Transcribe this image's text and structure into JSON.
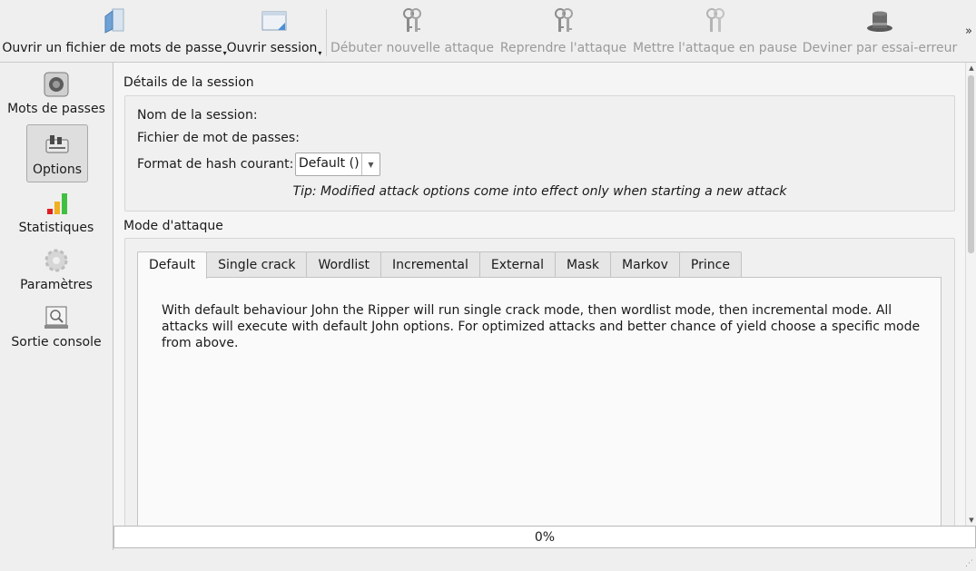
{
  "toolbar": {
    "open_password_file": "Ouvrir un fichier de mots de passe",
    "open_session": "Ouvrir session",
    "start_attack": "Débuter nouvelle attaque",
    "resume_attack": "Reprendre l'attaque",
    "pause_attack": "Mettre l'attaque en pause",
    "guess": "Deviner par essai-erreur",
    "more": "»"
  },
  "sidebar": {
    "items": [
      {
        "label": "Mots de passes",
        "icon": "safe-icon"
      },
      {
        "label": "Options",
        "icon": "options-icon"
      },
      {
        "label": "Statistiques",
        "icon": "statistics-icon"
      },
      {
        "label": "Paramètres",
        "icon": "settings-gear-icon"
      },
      {
        "label": "Sortie console",
        "icon": "console-output-icon"
      }
    ]
  },
  "session": {
    "title": "Détails de la session",
    "name_label": "Nom de la session:",
    "file_label": "Fichier de mot de passes:",
    "format_label": "Format de hash courant:",
    "format_value": "Default ()",
    "tip": "Tip: Modified attack options come into effect only when starting a new attack"
  },
  "attack": {
    "title": "Mode d'attaque",
    "tabs": [
      "Default",
      "Single crack",
      "Wordlist",
      "Incremental",
      "External",
      "Mask",
      "Markov",
      "Prince"
    ],
    "description": "With default behaviour John the Ripper will run single crack mode, then wordlist mode, then incremental mode. All attacks will execute with default John options. For optimized attacks and better chance of yield choose a specific mode from above."
  },
  "progress": {
    "value": 0,
    "label": "0%"
  }
}
